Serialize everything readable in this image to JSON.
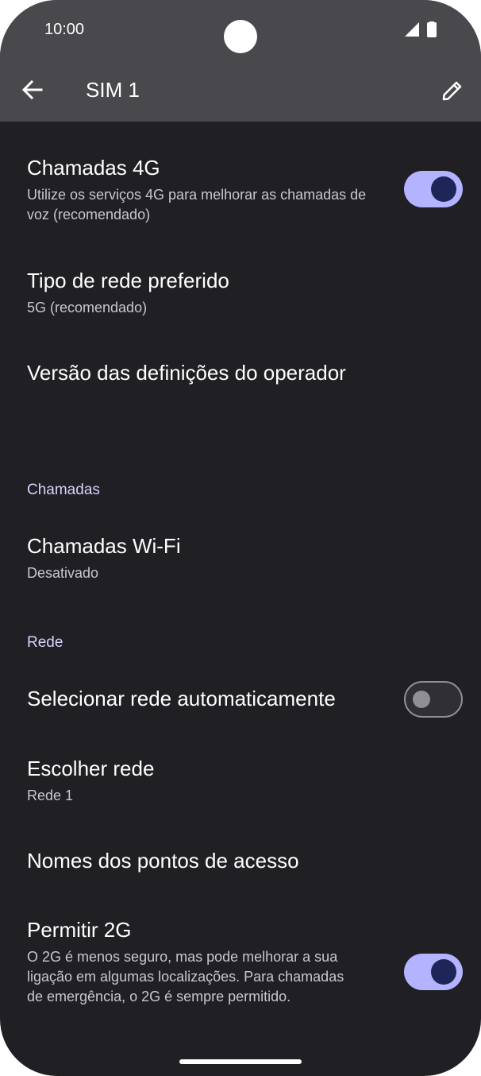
{
  "status_bar": {
    "time": "10:00",
    "signal_icon": "cellular-signal-icon",
    "battery_icon": "battery-icon"
  },
  "app_bar": {
    "title": "SIM 1",
    "back_icon": "arrow-back-icon",
    "edit_icon": "pencil-edit-icon"
  },
  "settings": {
    "volte": {
      "title": "Chamadas 4G",
      "summary": "Utilize os serviços 4G para melhorar as chamadas de voz (recomendado)",
      "enabled": true
    },
    "network_type": {
      "title": "Tipo de rede preferido",
      "summary": "5G (recomendado)"
    },
    "carrier_version": {
      "title": "Versão das definições do operador"
    },
    "section_calls": "Chamadas",
    "wifi_calling": {
      "title": "Chamadas Wi-Fi",
      "summary": "Desativado"
    },
    "section_network": "Rede",
    "auto_select": {
      "title": "Selecionar rede automaticamente",
      "enabled": false
    },
    "choose_network": {
      "title": "Escolher rede",
      "summary": "Rede 1"
    },
    "apn": {
      "title": "Nomes dos pontos de acesso"
    },
    "allow_2g": {
      "title": "Permitir 2G",
      "summary": "O 2G é menos seguro, mas pode melhorar a sua ligação em algumas localizações. Para chamadas de emergência, o 2G é sempre permitido.",
      "enabled": true
    }
  },
  "colors": {
    "background": "#1f1f24",
    "app_bar": "#48484d",
    "accent": "#b3b3ff",
    "section_header": "#d7d2ff"
  }
}
